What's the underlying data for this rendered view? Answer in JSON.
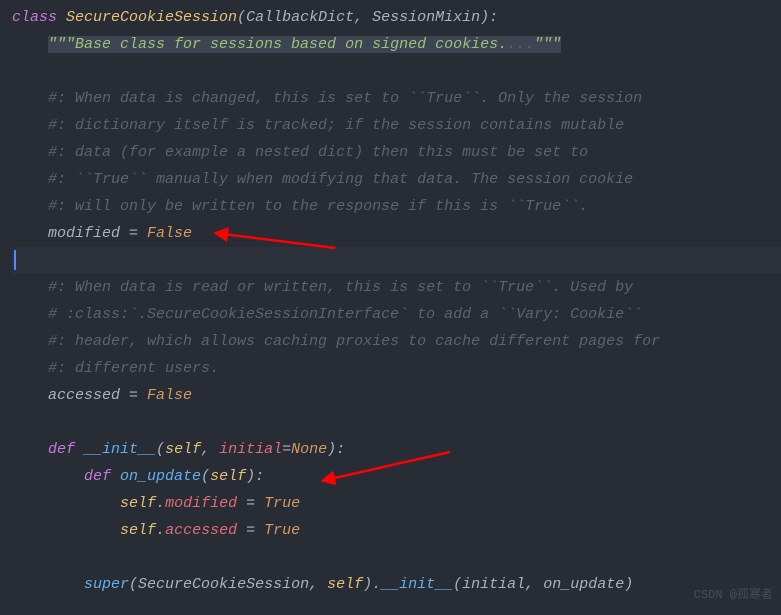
{
  "lines": {
    "l1_kw": "class ",
    "l1_cls": "SecureCookieSession",
    "l1_rest1": "(",
    "l1_p1": "CallbackDict",
    "l1_c": ", ",
    "l1_p2": "SessionMixin",
    "l1_rest2": "):",
    "l2_indent": "    ",
    "l2_str1": "\"\"\"Base class for sessions based on signed cookies.",
    "l2_str2": "...",
    "l2_str3": "\"\"\"",
    "l4_indent": "    ",
    "l4_cmt": "#: When data is changed, this is set to ``True``. Only the session",
    "l5_indent": "    ",
    "l5_cmt": "#: dictionary itself is tracked; if the session contains mutable",
    "l6_indent": "    ",
    "l6_cmt": "#: data (for example a nested dict) then this must be set to",
    "l7_indent": "    ",
    "l7_cmt": "#: ``True`` manually when modifying that data. The session cookie",
    "l8_indent": "    ",
    "l8_cmt": "#: will only be written to the response if this is ``True``.",
    "l9_indent": "    ",
    "l9_ident": "modified",
    "l9_eq": " = ",
    "l9_val": "False",
    "l11_indent": "    ",
    "l11_cmt": "#: When data is read or written, this is set to ``True``. Used by",
    "l12_indent": "    ",
    "l12_cmt": "# :class:`.SecureCookieSessionInterface` to add a ``Vary: Cookie``",
    "l13_indent": "    ",
    "l13_cmt": "#: header, which allows caching proxies to cache different pages for",
    "l14_indent": "    ",
    "l14_cmt": "#: different users.",
    "l15_indent": "    ",
    "l15_ident": "accessed",
    "l15_eq": " = ",
    "l15_val": "False",
    "l17_indent": "    ",
    "l17_def": "def ",
    "l17_fn": "__init__",
    "l17_p1": "(",
    "l17_self": "self",
    "l17_c": ", ",
    "l17_arg": "initial",
    "l17_eq": "=",
    "l17_none": "None",
    "l17_p2": "):",
    "l18_indent": "        ",
    "l18_def": "def ",
    "l18_fn": "on_update",
    "l18_p1": "(",
    "l18_self": "self",
    "l18_p2": "):",
    "l19_indent": "            ",
    "l19_self": "self",
    "l19_dot": ".",
    "l19_attr": "modified",
    "l19_eq": " = ",
    "l19_val": "True",
    "l20_indent": "            ",
    "l20_self": "self",
    "l20_dot": ".",
    "l20_attr": "accessed",
    "l20_eq": " = ",
    "l20_val": "True",
    "l22_indent": "        ",
    "l22_fn": "super",
    "l22_p1": "(",
    "l22_cls": "SecureCookieSession",
    "l22_c1": ", ",
    "l22_self": "self",
    "l22_p2": ").",
    "l22_init": "__init__",
    "l22_p3": "(",
    "l22_arg1": "initial",
    "l22_c2": ", ",
    "l22_arg2": "on_update",
    "l22_p4": ")"
  },
  "watermark": "CSDN @孤寒者",
  "arrows": {
    "color": "#ff0000"
  }
}
